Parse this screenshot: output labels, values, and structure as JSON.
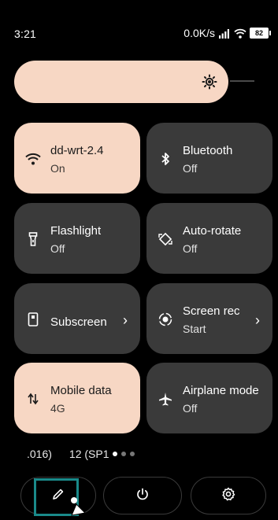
{
  "status_bar": {
    "time": "3:21",
    "net_speed": "0.0K/s",
    "battery": "82",
    "icons": [
      "signal-icon",
      "wifi-icon",
      "battery-icon"
    ]
  },
  "brightness": {
    "icon": "brightness-icon",
    "level_percent": 85
  },
  "tiles": [
    {
      "label": "dd-wrt-2.4",
      "sub": "On",
      "icon": "wifi-icon",
      "active": true
    },
    {
      "label": "Bluetooth",
      "sub": "Off",
      "icon": "bluetooth-icon",
      "active": false
    },
    {
      "label": "Flashlight",
      "sub": "Off",
      "icon": "flashlight-icon",
      "active": false
    },
    {
      "label": "Auto-rotate",
      "sub": "Off",
      "icon": "auto-rotate-icon",
      "active": false
    },
    {
      "label": "Subscreen",
      "sub": "",
      "icon": "subscreen-icon",
      "active": false
    },
    {
      "label": "Screen rec",
      "sub": "Start",
      "icon": "screen-record-icon",
      "active": false
    },
    {
      "label": "Mobile data",
      "sub": "4G",
      "icon": "mobile-data-icon",
      "active": true
    },
    {
      "label": "Airplane mode",
      "sub": "Off",
      "icon": "airplane-icon",
      "active": false
    }
  ],
  "build": {
    "part1": ".016)",
    "part2": "12 (SP1"
  },
  "pagination": {
    "pages": 3,
    "current": 1
  },
  "bottom_bar": {
    "edit_icon": "pencil-icon",
    "power_icon": "power-icon",
    "settings_icon": "gear-icon"
  },
  "colors": {
    "background": "#000000",
    "tile_active": "#f7d7c4",
    "tile_inactive": "#3a3a3a",
    "highlight": "#1a8a8a"
  }
}
